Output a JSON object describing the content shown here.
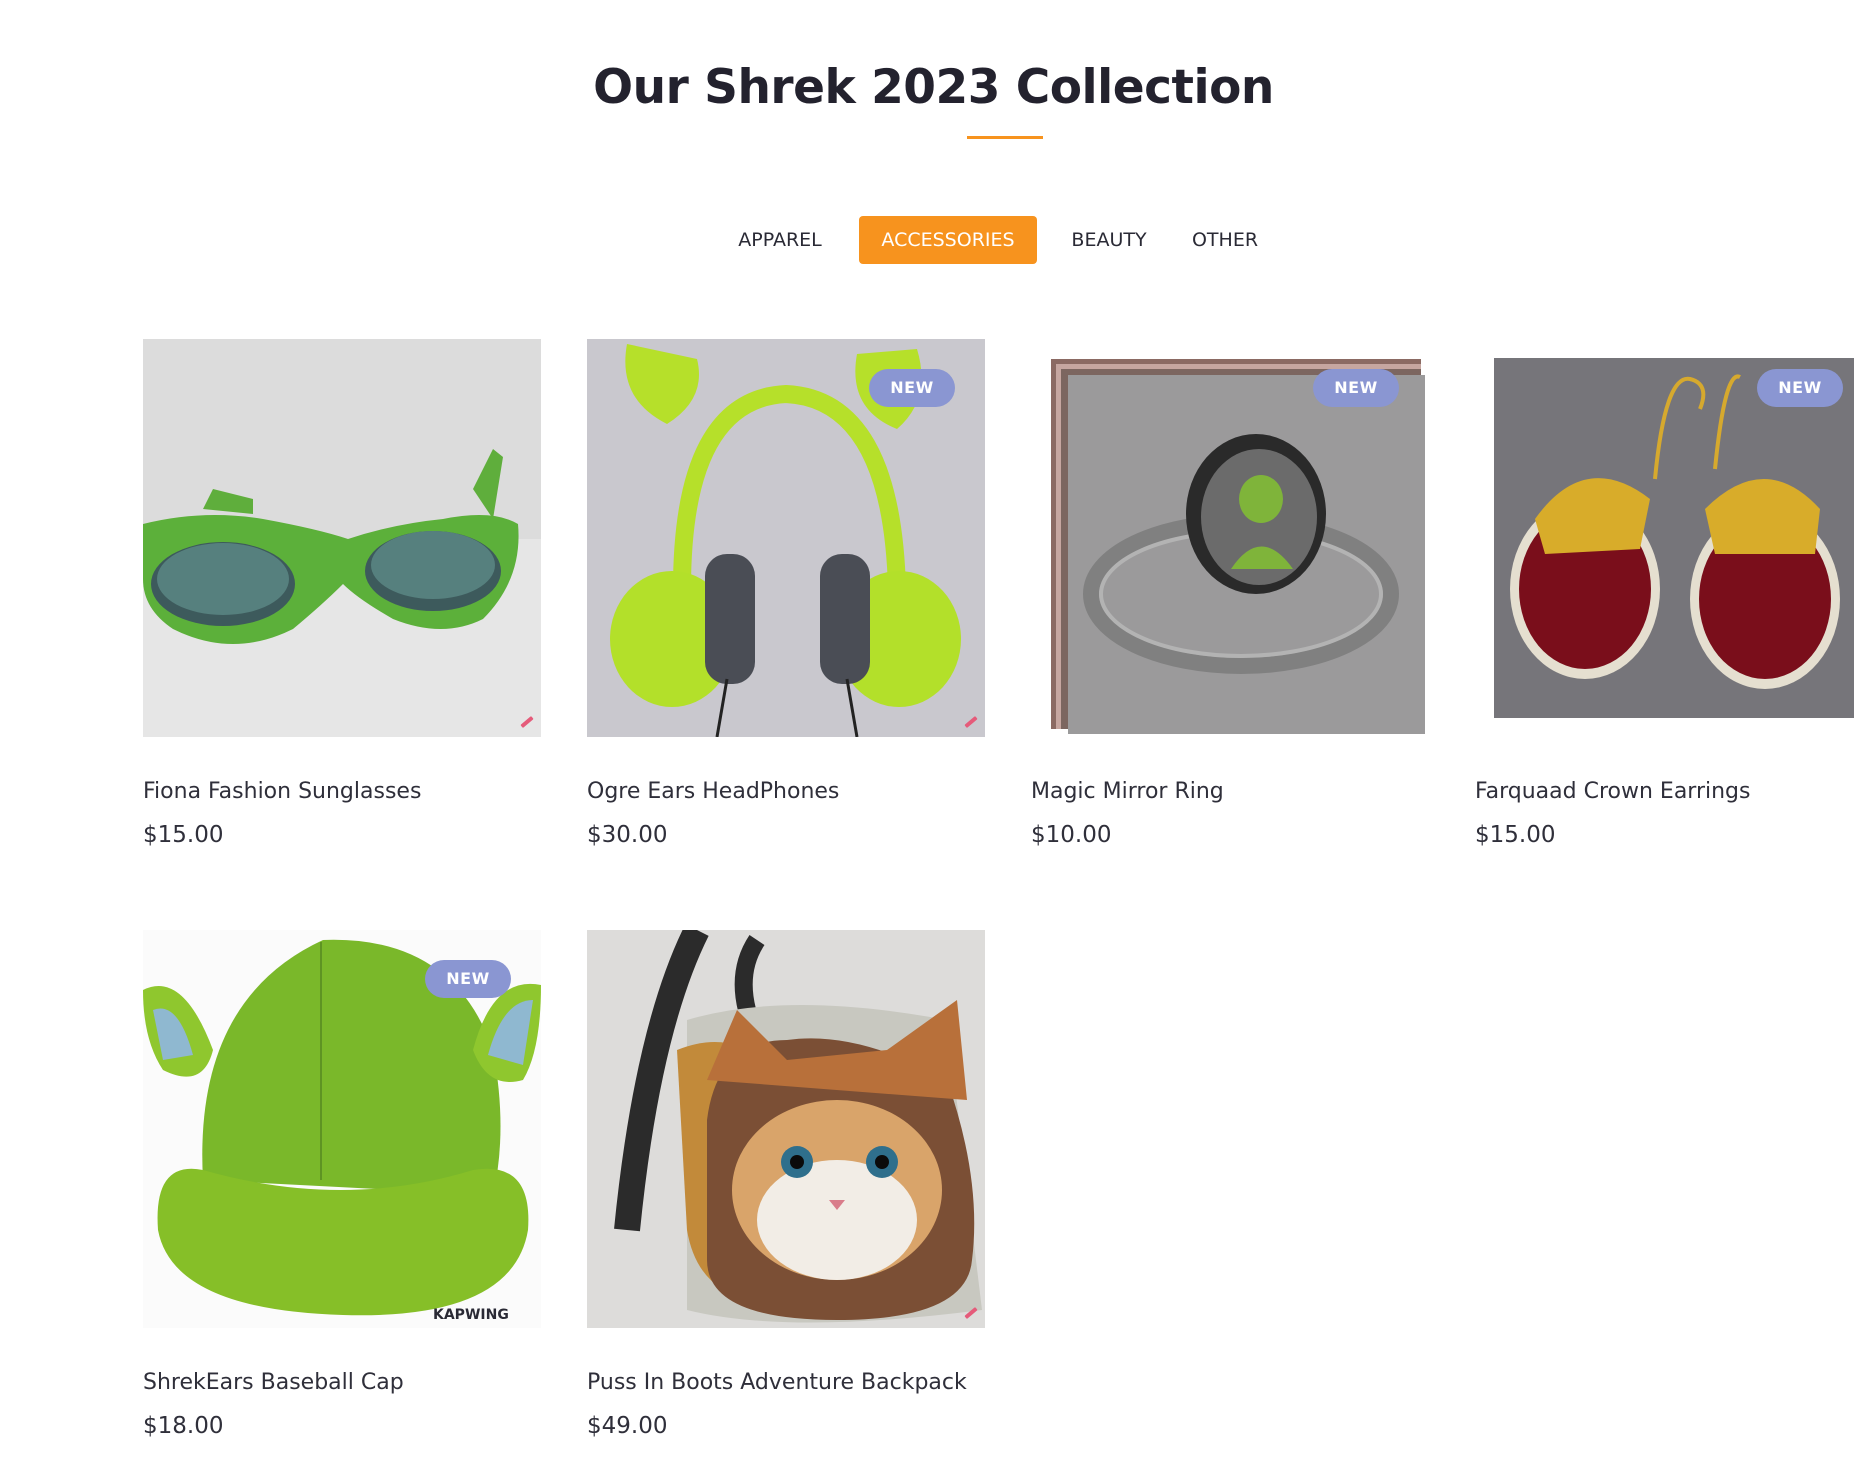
{
  "page": {
    "title": "Our Shrek 2023 Collection"
  },
  "tabs": [
    {
      "label": "APPAREL",
      "active": false
    },
    {
      "label": "ACCESSORIES",
      "active": true
    },
    {
      "label": "BEAUTY",
      "active": false
    },
    {
      "label": "OTHER",
      "active": false
    }
  ],
  "colors": {
    "accent": "#f7931e",
    "badge": "#8a96d2",
    "title": "#23222e"
  },
  "badge_label": "NEW",
  "products": [
    {
      "name": "Fiona Fashion Sunglasses",
      "price": "$15.00",
      "new": false,
      "image": "green-sunglasses"
    },
    {
      "name": "Ogre Ears HeadPhones",
      "price": "$30.00",
      "new": true,
      "image": "green-headphones-with-ogre-ears"
    },
    {
      "name": "Magic Mirror Ring",
      "price": "$10.00",
      "new": true,
      "image": "silver-ring-with-portrait"
    },
    {
      "name": "Farquaad Crown Earrings",
      "price": "$15.00",
      "new": true,
      "image": "red-crown-earrings"
    },
    {
      "name": "ShrekEars Baseball Cap",
      "price": "$18.00",
      "new": true,
      "image": "green-cap-with-ogre-ears",
      "watermark": "KAPWING"
    },
    {
      "name": "Puss In Boots Adventure Backpack",
      "price": "$49.00",
      "new": false,
      "image": "cat-face-backpack"
    }
  ]
}
